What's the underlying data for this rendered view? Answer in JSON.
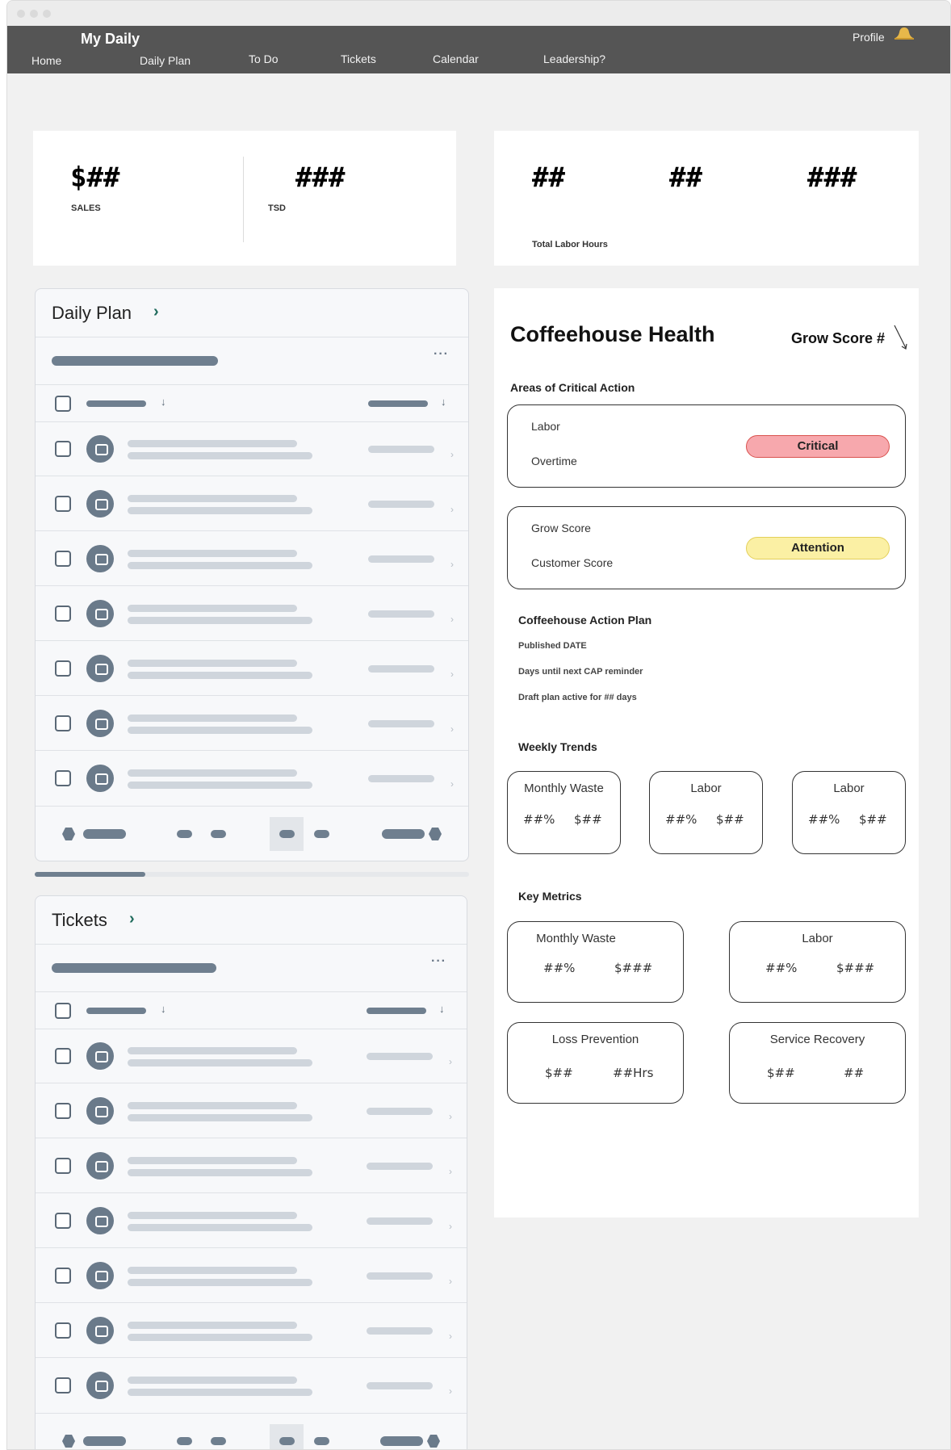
{
  "nav": {
    "brand": "My Daily",
    "items": [
      "Home",
      "Daily Plan",
      "To Do",
      "Tickets",
      "Calendar",
      "Leadership?"
    ],
    "profile": "Profile",
    "bell_icon": "bell-icon"
  },
  "stats_left": {
    "sales_value": "$##",
    "sales_label": "SALES",
    "tsd_value": "###",
    "tsd_label": "TSD"
  },
  "stats_right": {
    "values": [
      "##",
      "##",
      "###"
    ],
    "label": "Total Labor Hours"
  },
  "daily_plan": {
    "title": "Daily Plan",
    "row_count": 7
  },
  "tickets": {
    "title": "Tickets",
    "row_count": 7
  },
  "health": {
    "title": "Coffeehouse Health",
    "grow_score": "Grow Score #",
    "critical_section": "Areas of Critical Action",
    "box1": {
      "line1": "Labor",
      "line2": "Overtime",
      "status": "Critical",
      "status_color": "#f7a8ad"
    },
    "box2": {
      "line1": "Grow Score",
      "line2": "Customer Score",
      "status": "Attention",
      "status_color": "#fbf0a4"
    },
    "cap_title": "Coffeehouse Action Plan",
    "cap_lines": [
      "Published DATE",
      "Days until next CAP reminder",
      "Draft plan active for ## days"
    ],
    "weekly_title": "Weekly Trends",
    "weekly": [
      {
        "title": "Monthly Waste",
        "v1": "##%",
        "v2": "$##"
      },
      {
        "title": "Labor",
        "v1": "##%",
        "v2": "$##"
      },
      {
        "title": "Labor",
        "v1": "##%",
        "v2": "$##"
      }
    ],
    "key_title": "Key Metrics",
    "key": [
      {
        "title": "Monthly Waste",
        "v1": "##%",
        "v2": "$###"
      },
      {
        "title": "Labor",
        "v1": "##%",
        "v2": "$###"
      },
      {
        "title": "Loss Prevention",
        "v1": "$##",
        "v2": "##Hrs"
      },
      {
        "title": "Service Recovery",
        "v1": "$##",
        "v2": "##"
      }
    ]
  }
}
